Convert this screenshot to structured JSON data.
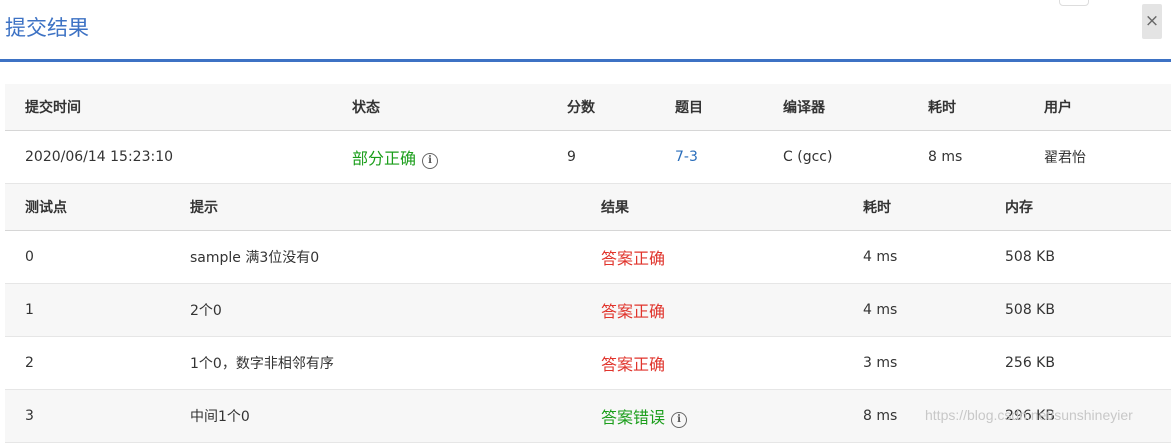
{
  "dialog": {
    "title": "提交结果",
    "close_label": "×"
  },
  "summary": {
    "headers": [
      "提交时间",
      "状态",
      "分数",
      "题目",
      "编译器",
      "耗时",
      "用户"
    ],
    "row": {
      "time": "2020/06/14 15:23:10",
      "status": "部分正确",
      "score": "9",
      "problem": "7-3",
      "compiler": "C (gcc)",
      "elapsed": "8 ms",
      "user": "翟君怡"
    }
  },
  "cases": {
    "headers": [
      "测试点",
      "提示",
      "结果",
      "耗时",
      "内存"
    ],
    "rows": [
      {
        "id": "0",
        "hint": "sample 满3位没有0",
        "result": "答案正确",
        "time": "4 ms",
        "memory": "508 KB"
      },
      {
        "id": "1",
        "hint": "2个0",
        "result": "答案正确",
        "time": "4 ms",
        "memory": "508 KB"
      },
      {
        "id": "2",
        "hint": "1个0，数字非相邻有序",
        "result": "答案正确",
        "time": "3 ms",
        "memory": "256 KB"
      },
      {
        "id": "3",
        "hint": "中间1个0",
        "result": "答案错误",
        "time": "8 ms",
        "memory": "296 KB"
      }
    ]
  },
  "colors": {
    "accent": "#3d72c4",
    "correct": "#e0342c",
    "partial": "#1b9e1b",
    "link": "#2a6ebb"
  },
  "icons": {
    "status_info": "info-circle-icon",
    "close": "close-icon"
  },
  "watermark": "https://blog.csdn.net/sunshineyier"
}
